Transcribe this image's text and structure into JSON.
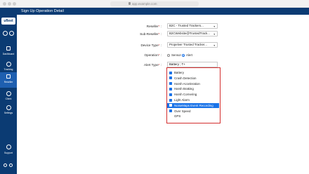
{
  "browser": {
    "url": "app.example.com"
  },
  "sidebar": {
    "logo": "ufleet",
    "items": [
      {
        "label": "Dashboard"
      },
      {
        "label": "Tracking"
      },
      {
        "label": "Reseller"
      },
      {
        "label": "Client"
      },
      {
        "label": "Settings"
      },
      {
        "label": "Support"
      }
    ]
  },
  "header": {
    "title": "Sign Up Operation Detail"
  },
  "form": {
    "reseller_label": "Reseller",
    "reseller_value": "B2C - Trusted Trackers...",
    "subreseller_label": "Sub-Reseller",
    "subreseller_value": "B2CWebsite@TrustedTrack...",
    "device_type_label": "Device Type",
    "device_type_value": "Propelver Trusted Tracker...",
    "operation_label": "Operation",
    "operation_options": [
      "Sensor",
      "Alert"
    ],
    "operation_selected": "Alert",
    "alert_type_label": "Alert Type",
    "alert_type_value": "Battery ; T+",
    "required_mark": "*",
    "label_colon": ":"
  },
  "alert_options": [
    {
      "label": "Battery",
      "checked": true,
      "highlighted": false
    },
    {
      "label": "Crash Detection",
      "checked": true,
      "highlighted": false
    },
    {
      "label": "Harsh Acceleration",
      "checked": true,
      "highlighted": false
    },
    {
      "label": "Harsh Braking",
      "checked": true,
      "highlighted": false
    },
    {
      "label": "Harsh Cornering",
      "checked": true,
      "highlighted": false
    },
    {
      "label": "Light Alarm",
      "checked": true,
      "highlighted": false
    },
    {
      "label": "NoiseMaps Event Recording",
      "checked": true,
      "highlighted": true
    },
    {
      "label": "Over Speed",
      "checked": true,
      "highlighted": false
    },
    {
      "label": "GPS",
      "checked": false,
      "highlighted": false
    }
  ],
  "colors": {
    "sidebar": "#0b3b73",
    "accent": "#1a73e8",
    "highlight_border": "#d32f2f"
  }
}
